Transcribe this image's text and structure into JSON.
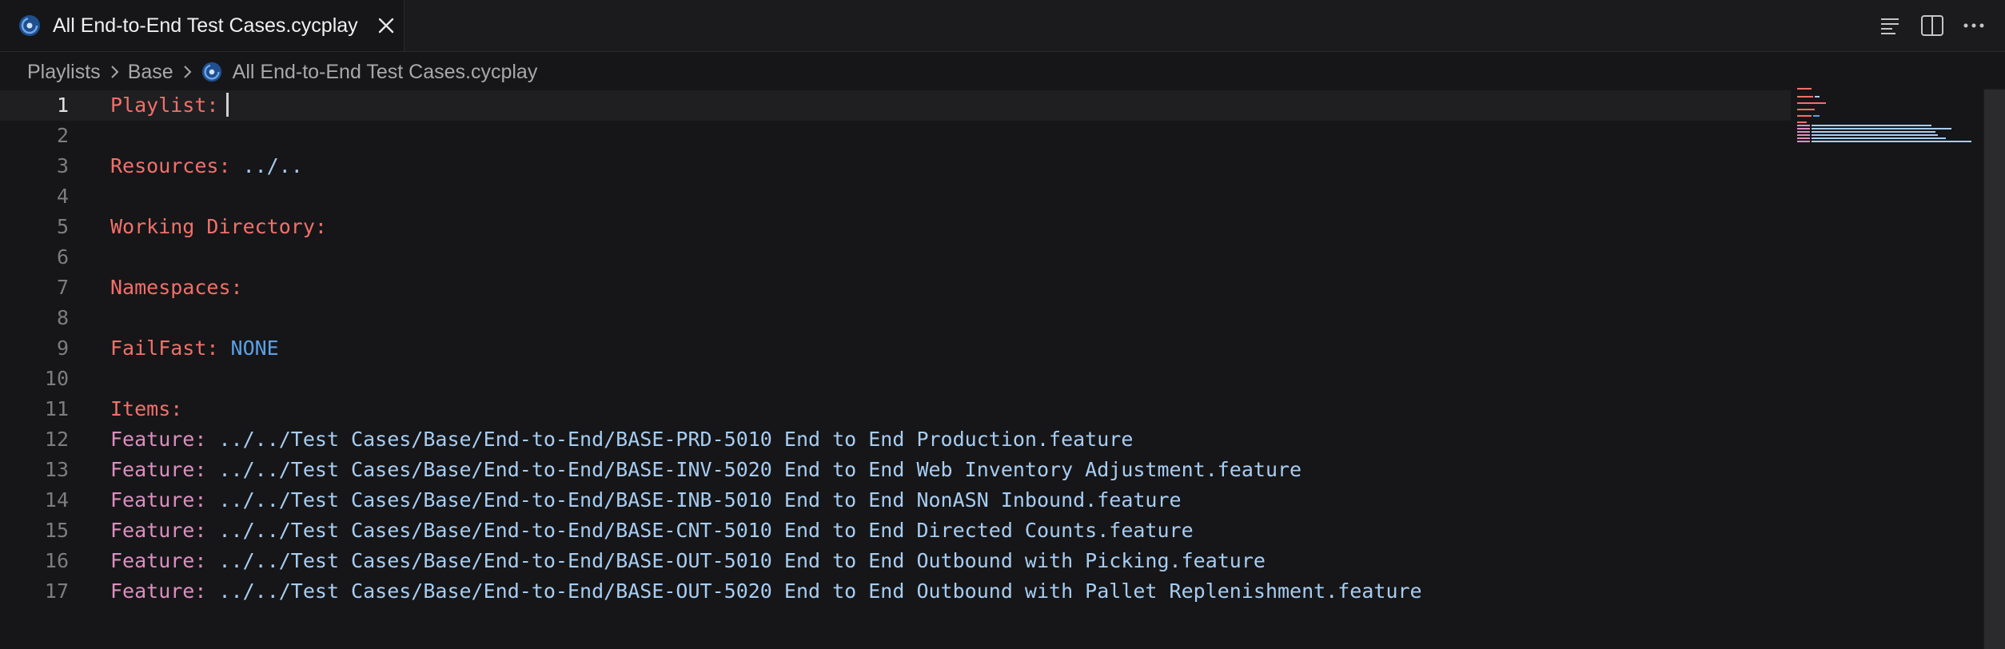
{
  "tab": {
    "label": "All End-to-End Test Cases.cycplay",
    "file_icon": "cycplay-file-icon",
    "close_icon": "close-icon"
  },
  "editor_actions": [
    "outline-icon",
    "split-editor-icon",
    "more-actions-icon"
  ],
  "breadcrumbs": {
    "items": [
      "Playlists",
      "Base",
      "All End-to-End Test Cases.cycplay"
    ]
  },
  "editor": {
    "current_line": 1,
    "lines": [
      {
        "n": "1",
        "key": "Playlist:",
        "value": ""
      },
      {
        "n": "2",
        "key": "",
        "value": ""
      },
      {
        "n": "3",
        "key": "Resources:",
        "value": "../.."
      },
      {
        "n": "4",
        "key": "",
        "value": ""
      },
      {
        "n": "5",
        "key": "Working Directory:",
        "value": ""
      },
      {
        "n": "6",
        "key": "",
        "value": ""
      },
      {
        "n": "7",
        "key": "Namespaces:",
        "value": ""
      },
      {
        "n": "8",
        "key": "",
        "value": ""
      },
      {
        "n": "9",
        "key": "FailFast:",
        "value": "NONE"
      },
      {
        "n": "10",
        "key": "",
        "value": ""
      },
      {
        "n": "11",
        "key": "Items:",
        "value": ""
      },
      {
        "n": "12",
        "key": "Feature:",
        "value": "../../Test Cases/Base/End-to-End/BASE-PRD-5010 End to End Production.feature"
      },
      {
        "n": "13",
        "key": "Feature:",
        "value": "../../Test Cases/Base/End-to-End/BASE-INV-5020 End to End Web Inventory Adjustment.feature"
      },
      {
        "n": "14",
        "key": "Feature:",
        "value": "../../Test Cases/Base/End-to-End/BASE-INB-5010 End to End NonASN Inbound.feature"
      },
      {
        "n": "15",
        "key": "Feature:",
        "value": "../../Test Cases/Base/End-to-End/BASE-CNT-5010 End to End Directed Counts.feature"
      },
      {
        "n": "16",
        "key": "Feature:",
        "value": "../../Test Cases/Base/End-to-End/BASE-OUT-5010 End to End Outbound with Picking.feature"
      },
      {
        "n": "17",
        "key": "Feature:",
        "value": "../../Test Cases/Base/End-to-End/BASE-OUT-5020 End to End Outbound with Pallet Replenishment.feature"
      }
    ]
  },
  "colors": {
    "header_key": "#f2706a",
    "feature_key": "#dc8fc0",
    "path_value": "#a8cdf2",
    "const_value": "#5ba0e8",
    "background": "#161618"
  }
}
